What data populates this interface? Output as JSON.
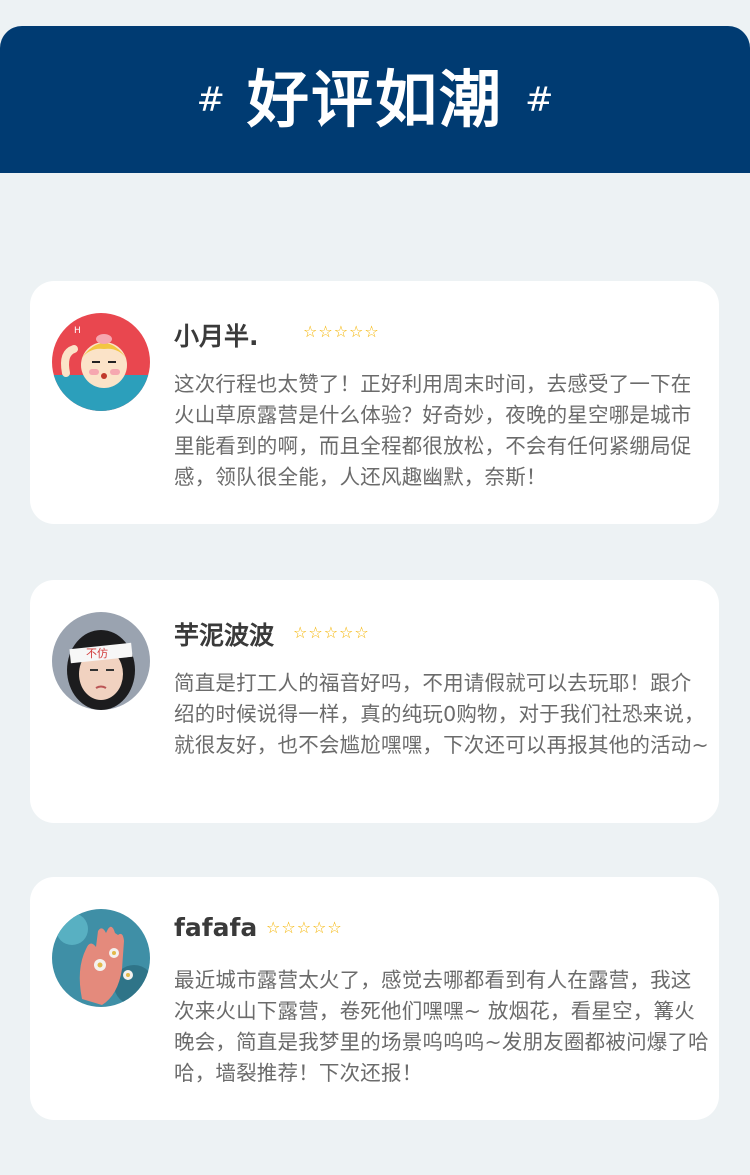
{
  "header": {
    "hash_left": "#",
    "title": "好评如潮",
    "hash_right": "#"
  },
  "colors": {
    "header_bg": "#003b72",
    "page_bg": "#edf2f4",
    "star": "#f5b400"
  },
  "reviews": [
    {
      "name": "小月半.",
      "stars": [
        "☆",
        "☆",
        "☆",
        "☆",
        "☆"
      ],
      "rating": 5,
      "avatar_icon": "cartoon-girl-avatar",
      "text": "这次行程也太赞了！正好利用周末时间，去感受了一下在火山草原露营是什么体验？好奇妙，夜晚的星空哪是城市里能看到的啊，而且全程都很放松，不会有任何紧绷局促感，领队很全能，人还风趣幽默，奈斯！"
    },
    {
      "name": "芋泥波波",
      "stars": [
        "☆",
        "☆",
        "☆",
        "☆",
        "☆"
      ],
      "rating": 5,
      "avatar_icon": "girl-headband-avatar",
      "text": "简直是打工人的福音好吗，不用请假就可以去玩耶！跟介绍的时候说得一样，真的纯玩0购物，对于我们社恐来说，就很友好，也不会尴尬嘿嘿，下次还可以再报其他的活动~"
    },
    {
      "name": "fafafa",
      "stars": [
        "☆",
        "☆",
        "☆",
        "☆",
        "☆"
      ],
      "rating": 5,
      "avatar_icon": "hand-flowers-avatar",
      "text": "最近城市露营太火了，感觉去哪都看到有人在露营，我这次来火山下露营，卷死他们嘿嘿~ 放烟花，看星空，篝火晚会，简直是我梦里的场景呜呜呜~发朋友圈都被问爆了哈哈，墙裂推荐！下次还报！"
    }
  ]
}
